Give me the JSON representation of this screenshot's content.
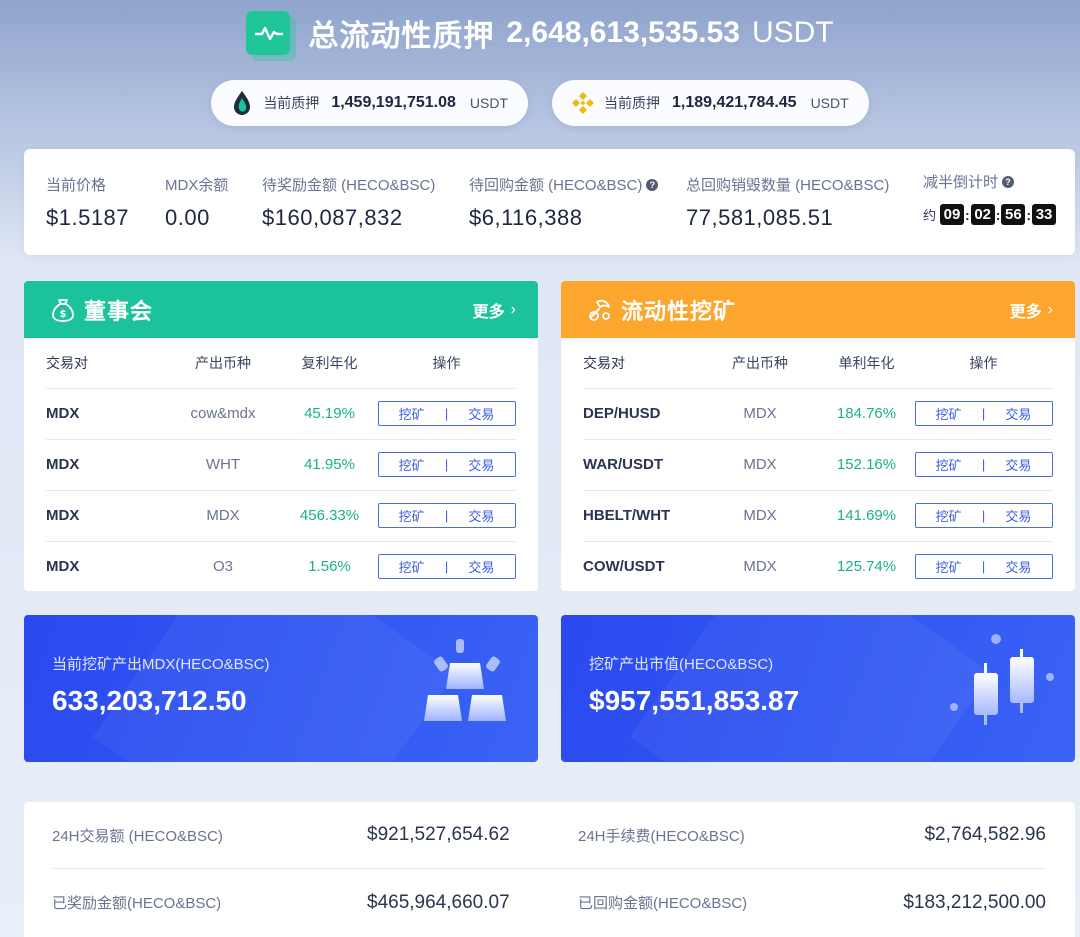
{
  "header": {
    "title": "总流动性质押",
    "amount": "2,648,613,535.53",
    "unit": "USDT",
    "pills": [
      {
        "icon": "heco-drop-icon",
        "label": "当前质押",
        "value": "1,459,191,751.08",
        "unit": "USDT"
      },
      {
        "icon": "bnb-icon",
        "label": "当前质押",
        "value": "1,189,421,784.45",
        "unit": "USDT"
      }
    ]
  },
  "stats": {
    "price": {
      "label": "当前价格",
      "value": "$1.5187"
    },
    "balance": {
      "label": "MDX余额",
      "value": "0.00"
    },
    "pending_reward": {
      "label": "待奖励金额 (HECO&BSC)",
      "value": "$160,087,832"
    },
    "pending_buyback": {
      "label": "待回购金额 (HECO&BSC)",
      "value": "$6,116,388"
    },
    "total_burn": {
      "label": "总回购销毁数量 (HECO&BSC)",
      "value": "77,581,085.51"
    },
    "halving": {
      "label": "减半倒计时",
      "prefix": "约",
      "d": "09",
      "h": "02",
      "m": "56",
      "s": "33"
    }
  },
  "board": {
    "title": "董事会",
    "more": "更多",
    "headers": [
      "交易对",
      "产出币种",
      "复利年化",
      "操作"
    ],
    "rows": [
      {
        "pair": "MDX",
        "coin": "cow&mdx",
        "apr": "45.19%"
      },
      {
        "pair": "MDX",
        "coin": "WHT",
        "apr": "41.95%"
      },
      {
        "pair": "MDX",
        "coin": "MDX",
        "apr": "456.33%"
      },
      {
        "pair": "MDX",
        "coin": "O3",
        "apr": "1.56%"
      }
    ]
  },
  "liquidity": {
    "title": "流动性挖矿",
    "more": "更多",
    "headers": [
      "交易对",
      "产出币种",
      "单利年化",
      "操作"
    ],
    "rows": [
      {
        "pair": "DEP/HUSD",
        "coin": "MDX",
        "apr": "184.76%"
      },
      {
        "pair": "WAR/USDT",
        "coin": "MDX",
        "apr": "152.16%"
      },
      {
        "pair": "HBELT/WHT",
        "coin": "MDX",
        "apr": "141.69%"
      },
      {
        "pair": "COW/USDT",
        "coin": "MDX",
        "apr": "125.74%"
      }
    ]
  },
  "actions": {
    "mine": "挖矿",
    "sep": "|",
    "trade": "交易"
  },
  "banners": {
    "mined": {
      "label": "当前挖矿产出MDX(HECO&BSC)",
      "value": "633,203,712.50"
    },
    "market_value": {
      "label": "挖矿产出市值(HECO&BSC)",
      "value": "$957,551,853.87"
    }
  },
  "bottom": {
    "volume": {
      "label": "24H交易额 (HECO&BSC)",
      "value": "$921,527,654.62"
    },
    "fees": {
      "label": "24H手续费(HECO&BSC)",
      "value": "$2,764,582.96"
    },
    "rewarded": {
      "label": "已奖励金额(HECO&BSC)",
      "value": "$465,964,660.07"
    },
    "bought_back": {
      "label": "已回购金额(HECO&BSC)",
      "value": "$183,212,500.00"
    }
  },
  "colors": {
    "green": "#1bc29c",
    "orange": "#fca62e",
    "blue": "#2f56f2",
    "apr_green": "#1bb08c"
  }
}
